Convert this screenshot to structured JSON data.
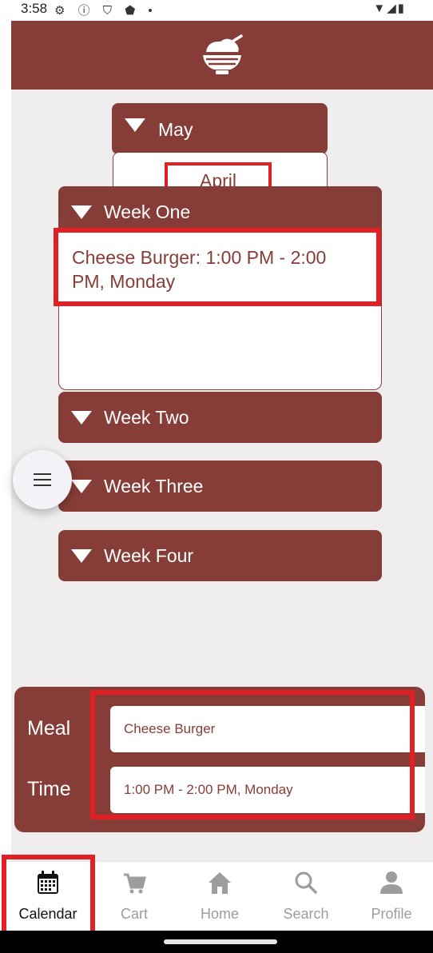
{
  "status_bar": {
    "time": "3:58",
    "left_icons": "⚙ ⓘ ⛉ ⬟ •",
    "right_icons": "▼◢▮"
  },
  "header": {
    "logo_icon": "rice-bowl-icon"
  },
  "month_selector": {
    "selected": "May",
    "option": "April"
  },
  "weeks": [
    {
      "label": "Week One",
      "expanded": true
    },
    {
      "label": "Week Two",
      "expanded": false
    },
    {
      "label": "Week Three",
      "expanded": false
    },
    {
      "label": "Week Four",
      "expanded": false
    }
  ],
  "week_one_events": [
    {
      "text": "Cheese Burger: 1:00 PM - 2:00 PM, Monday"
    }
  ],
  "meal_card": {
    "meal_label": "Meal",
    "meal_value": "Cheese Burger",
    "time_label": "Time",
    "time_value": "1:00 PM - 2:00 PM, Monday"
  },
  "bottom_nav": [
    {
      "label": "Calendar",
      "icon": "calendar-icon",
      "active": true
    },
    {
      "label": "Cart",
      "icon": "cart-icon",
      "active": false
    },
    {
      "label": "Home",
      "icon": "home-icon",
      "active": false
    },
    {
      "label": "Search",
      "icon": "search-icon",
      "active": false
    },
    {
      "label": "Profile",
      "icon": "profile-icon",
      "active": false
    }
  ],
  "colors": {
    "brand": "#873d37",
    "background": "#efeded",
    "highlight": "#e21f25"
  }
}
